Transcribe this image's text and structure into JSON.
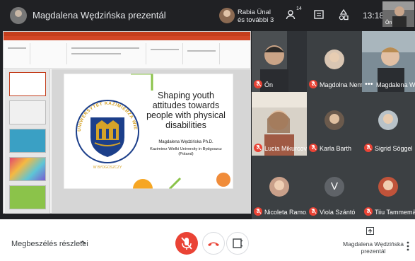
{
  "meeting": {
    "presenter_title": "Magdalena Wędzińska prezentál",
    "pinned_line1": "Rabia Ünal",
    "pinned_line2": "és további 3",
    "participant_count": "14",
    "time": "13:18",
    "self_label": "Ön"
  },
  "slide": {
    "title": "Shaping youth attitudes towards people with physical disabilities",
    "author": "Magdalena Wędzińska Ph.D.",
    "affiliation": "Kazimierz Wielki University in Bydgoszcz (Poland)",
    "seal_text": "UNIWERSYTET KAZIMIERZA WIELKIEGO",
    "seal_city": "W BYDGOSZCZY"
  },
  "participants": [
    {
      "name": "Ön",
      "muted": true
    },
    {
      "name": "Magdolna Nem...",
      "muted": true
    },
    {
      "name": "Magdalena Wę...",
      "muted": false,
      "more": true
    },
    {
      "name": "Lucia Mikurcov...",
      "muted": true
    },
    {
      "name": "Karla Barth",
      "muted": true
    },
    {
      "name": "Sigrid Söggel",
      "muted": true
    },
    {
      "name": "Nicoleta Ramo...",
      "muted": true
    },
    {
      "name": "Viola Szántó",
      "muted": true,
      "letter": "V"
    },
    {
      "name": "Tiiu Tammemäe",
      "muted": true
    }
  ],
  "bottom": {
    "details_label": "Megbeszélés részletei",
    "presenter_line1": "Magdalena Wędzińska",
    "presenter_line2": "prezentál"
  },
  "icons": {
    "people": "people-icon",
    "chat": "chat-icon",
    "activities": "activities-icon",
    "mic_off": "mic-off-icon",
    "hangup": "hangup-icon",
    "captions": "captions-icon",
    "present": "present-icon",
    "more": "more-vert-icon"
  },
  "colors": {
    "meet_bg": "#202124",
    "danger": "#ea4335",
    "powerpoint": "#c43e1c",
    "seal_blue": "#1c3f8a",
    "seal_gold": "#d5a329"
  }
}
